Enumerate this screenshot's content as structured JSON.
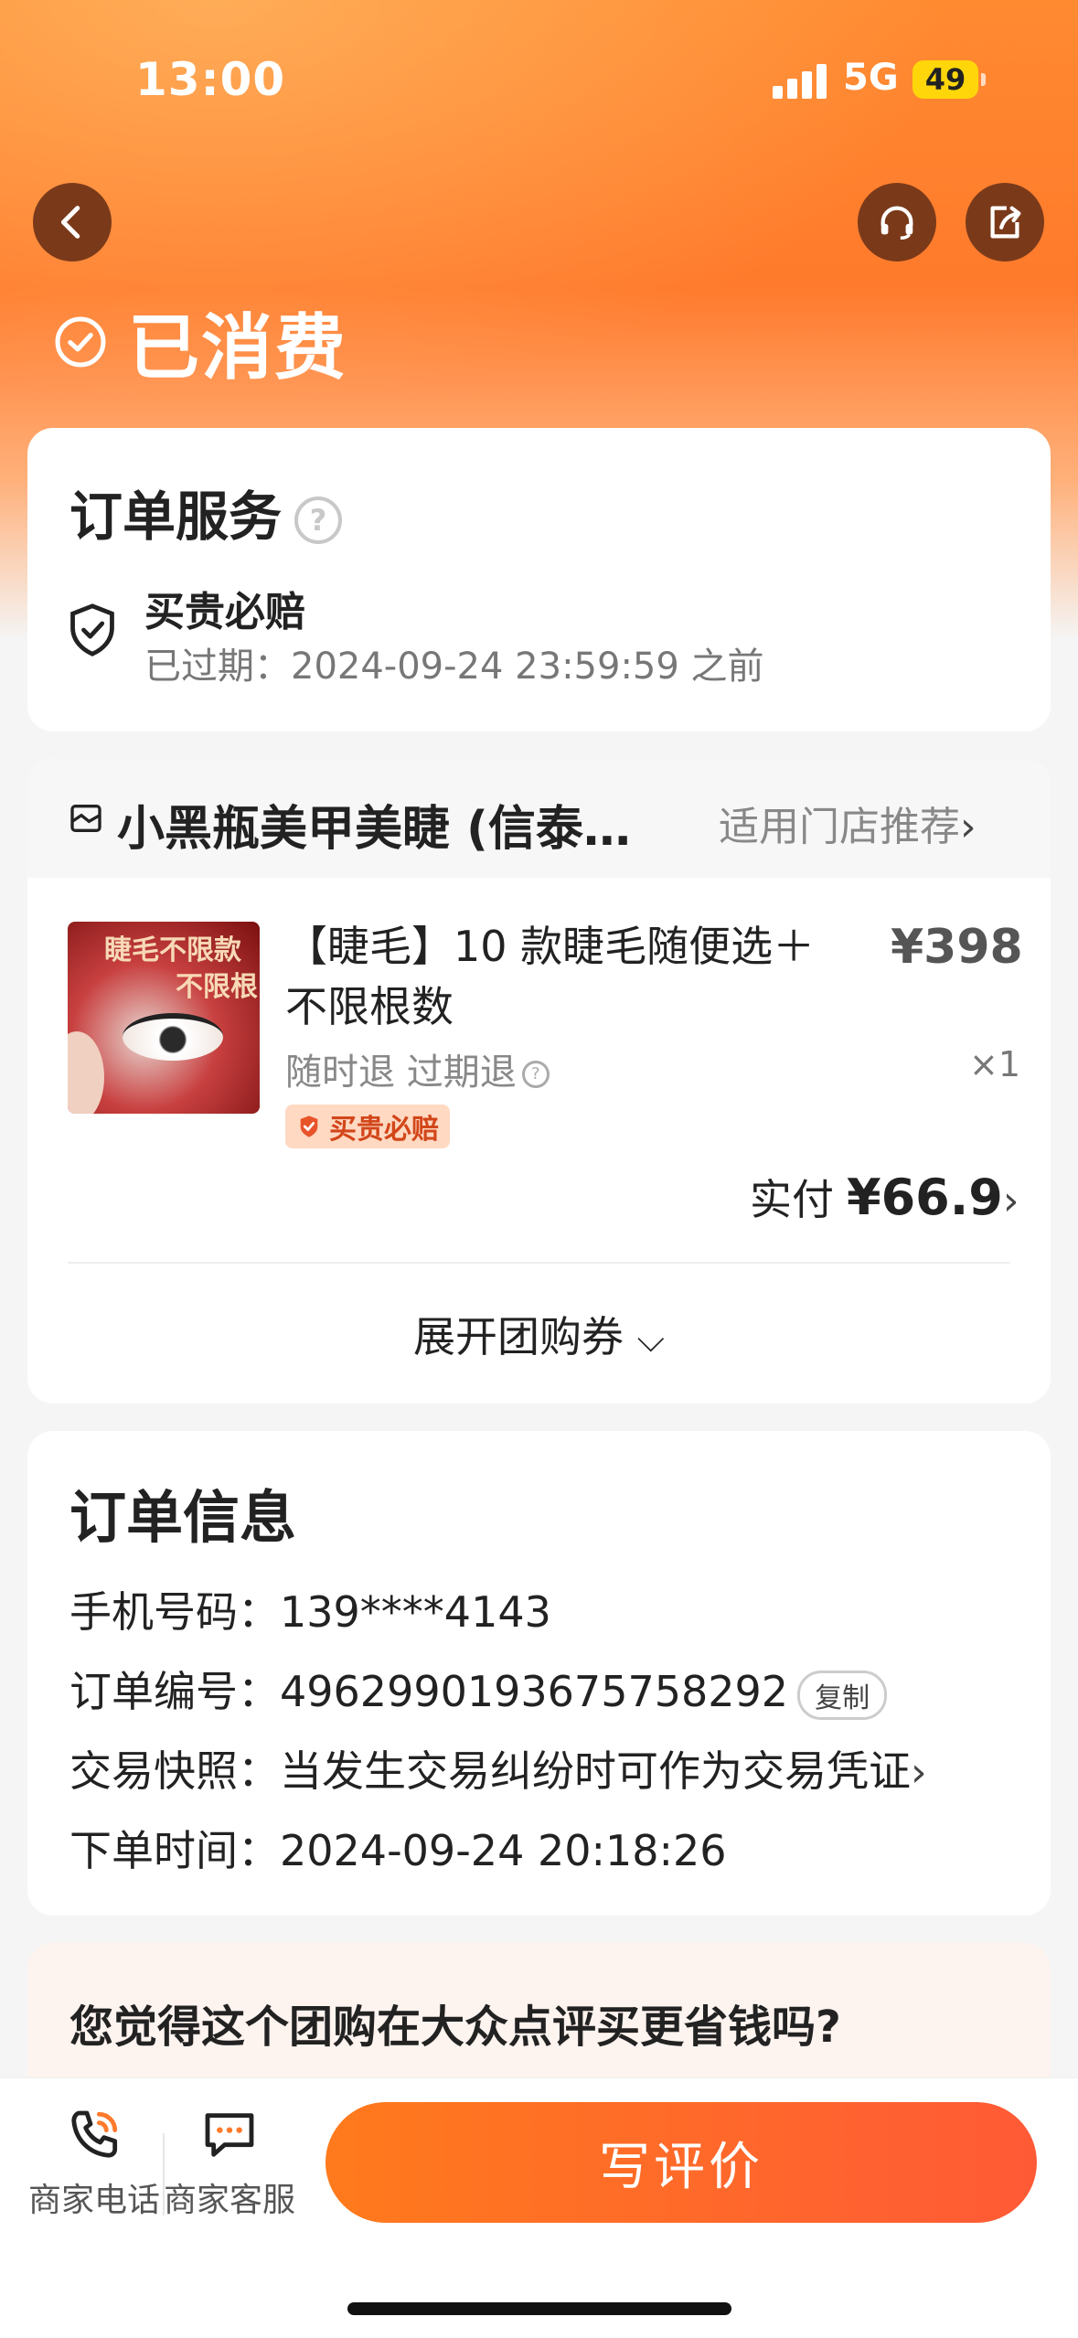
{
  "status_bar": {
    "time": "13:00",
    "network": "5G",
    "battery": "49"
  },
  "header": {
    "back_icon": "chevron-left-icon",
    "service_icon": "headset-icon",
    "share_icon": "share-icon",
    "status_text": "已消费",
    "colors": {
      "gradient_top": "#ff8a30",
      "gradient_mid": "#ff7a2c",
      "icon_bg": "#7a3a1a"
    }
  },
  "order_service": {
    "title": "订单服务",
    "help": "?",
    "guarantee_title": "买贵必赔",
    "guarantee_sub": "已过期：2024-09-24 23:59:59 之前"
  },
  "store": {
    "name": "小黑瓶美甲美睫 (信泰…",
    "recommend": "适用门店推荐"
  },
  "product": {
    "image_text_1": "睫毛不限款",
    "image_text_2": "不限根",
    "title": "【睫毛】10 款睫毛随便选＋不限根数",
    "price": "¥398",
    "refund": "随时退 过期退",
    "qty": "×1",
    "tag": "买贵必赔",
    "paid_label": "实付",
    "paid_amount": "¥66.9",
    "expand": "展开团购券"
  },
  "order_info": {
    "title": "订单信息",
    "rows": [
      {
        "label": "手机号码：",
        "value": "139****4143"
      },
      {
        "label": "订单编号：",
        "value": "4962990193675758292"
      },
      {
        "label": "交易快照：",
        "value": "当发生交易纠纷时可作为交易凭证"
      },
      {
        "label": "下单时间：",
        "value": "2024-09-24 20:18:26"
      }
    ],
    "copy": "复制"
  },
  "survey": {
    "question": "您觉得这个团购在大众点评买更省钱吗?"
  },
  "bottom": {
    "phone_label": "商家电话",
    "chat_label": "商家客服",
    "review": "写评价",
    "colors": {
      "btn_start": "#ff7a1c",
      "btn_end": "#ff5a36"
    }
  }
}
